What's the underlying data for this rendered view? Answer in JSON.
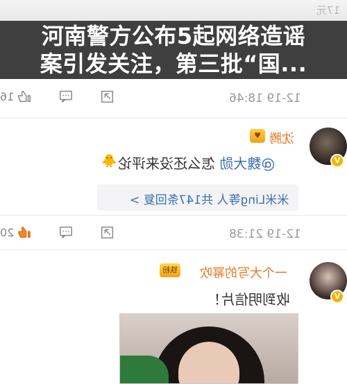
{
  "headline": {
    "line1": "河南警方公布5起网络造谣",
    "line2": "案引发关注，第三批“国..."
  },
  "top_strip": {
    "ghost_text": "17元"
  },
  "post1": {
    "like_count": "16",
    "timestamp": "12-19 18:46"
  },
  "comment1": {
    "username": "沈腾",
    "mention": "@魏大勋",
    "text": "怎么还没来评论",
    "emoji": "🐥",
    "reply_summary": "米米Ling等人 共147条回复 >",
    "like_count": "20",
    "timestamp": "12-19 21:38"
  },
  "comment2": {
    "username": "一个大写的幂吹",
    "badge": "铁粉",
    "text": "收到明信片！"
  },
  "icons": {
    "like": "thumbs-up-icon",
    "comment": "comment-icon",
    "share": "share-icon",
    "verified": "verified-badge-icon"
  },
  "colors": {
    "headline_bg": "#303030",
    "username": "#e07b2b",
    "mention": "#3a6fb0",
    "like_active": "#f08a2a"
  }
}
